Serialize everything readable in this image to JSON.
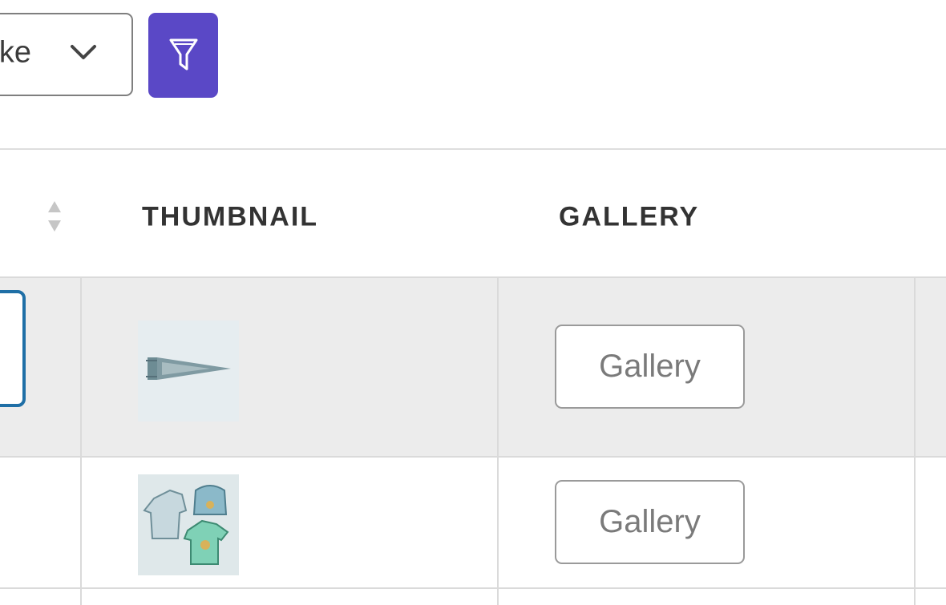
{
  "toolbar": {
    "select_value": "like",
    "select_chevron_icon": "chevron-down-icon",
    "filter_icon": "filter-funnel-icon",
    "filter_color": "#5a48c6"
  },
  "table": {
    "headers": {
      "thumbnail": "THUMBNAIL",
      "gallery": "GALLERY"
    },
    "sort_icon": "sort-arrows-icon",
    "rows": [
      {
        "thumbnail": "pennant-flag-image",
        "gallery_label": "Gallery",
        "selected": true
      },
      {
        "thumbnail": "clothing-set-image",
        "gallery_label": "Gallery",
        "selected": false
      }
    ]
  },
  "colors": {
    "row_highlight": "#ececec",
    "focus_border": "#1f6fa6"
  }
}
